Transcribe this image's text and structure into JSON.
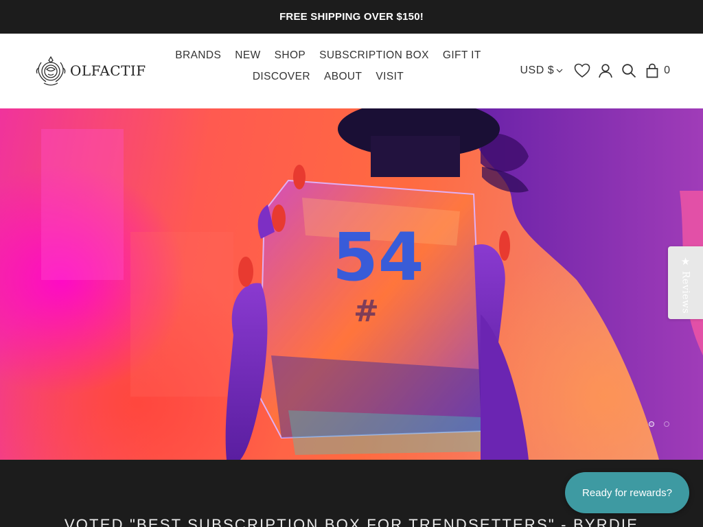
{
  "announcement": {
    "text": "FREE SHIPPING OVER $150!"
  },
  "header": {
    "logo_text": "OLFACTIF",
    "nav_row1": [
      {
        "label": "BRANDS",
        "name": "nav-brands"
      },
      {
        "label": "NEW",
        "name": "nav-new"
      },
      {
        "label": "SHOP",
        "name": "nav-shop"
      },
      {
        "label": "SUBSCRIPTION BOX",
        "name": "nav-subscription-box"
      },
      {
        "label": "GIFT IT",
        "name": "nav-gift-it"
      }
    ],
    "nav_row2": [
      {
        "label": "DISCOVER",
        "name": "nav-discover"
      },
      {
        "label": "ABOUT",
        "name": "nav-about"
      },
      {
        "label": "VISIT",
        "name": "nav-visit"
      }
    ],
    "currency": "USD $",
    "cart_count": "0",
    "icons": [
      "heart-icon",
      "account-icon",
      "search-icon",
      "cart-bag-icon"
    ]
  },
  "hero": {
    "bottle_label": "54",
    "slides_total": 2,
    "active_slide": 1
  },
  "reviews_tab": {
    "label": "Reviews",
    "icon": "star-icon"
  },
  "section": {
    "headline": "VOTED \"BEST SUBSCRIPTION BOX FOR TRENDSETTERS\" - BYRDIE"
  },
  "rewards": {
    "label": "Ready for rewards?",
    "color": "#3e9aa2"
  },
  "colors": {
    "bar_bg": "#1c1c1c",
    "header_bg": "#ffffff",
    "text": "#333333"
  }
}
